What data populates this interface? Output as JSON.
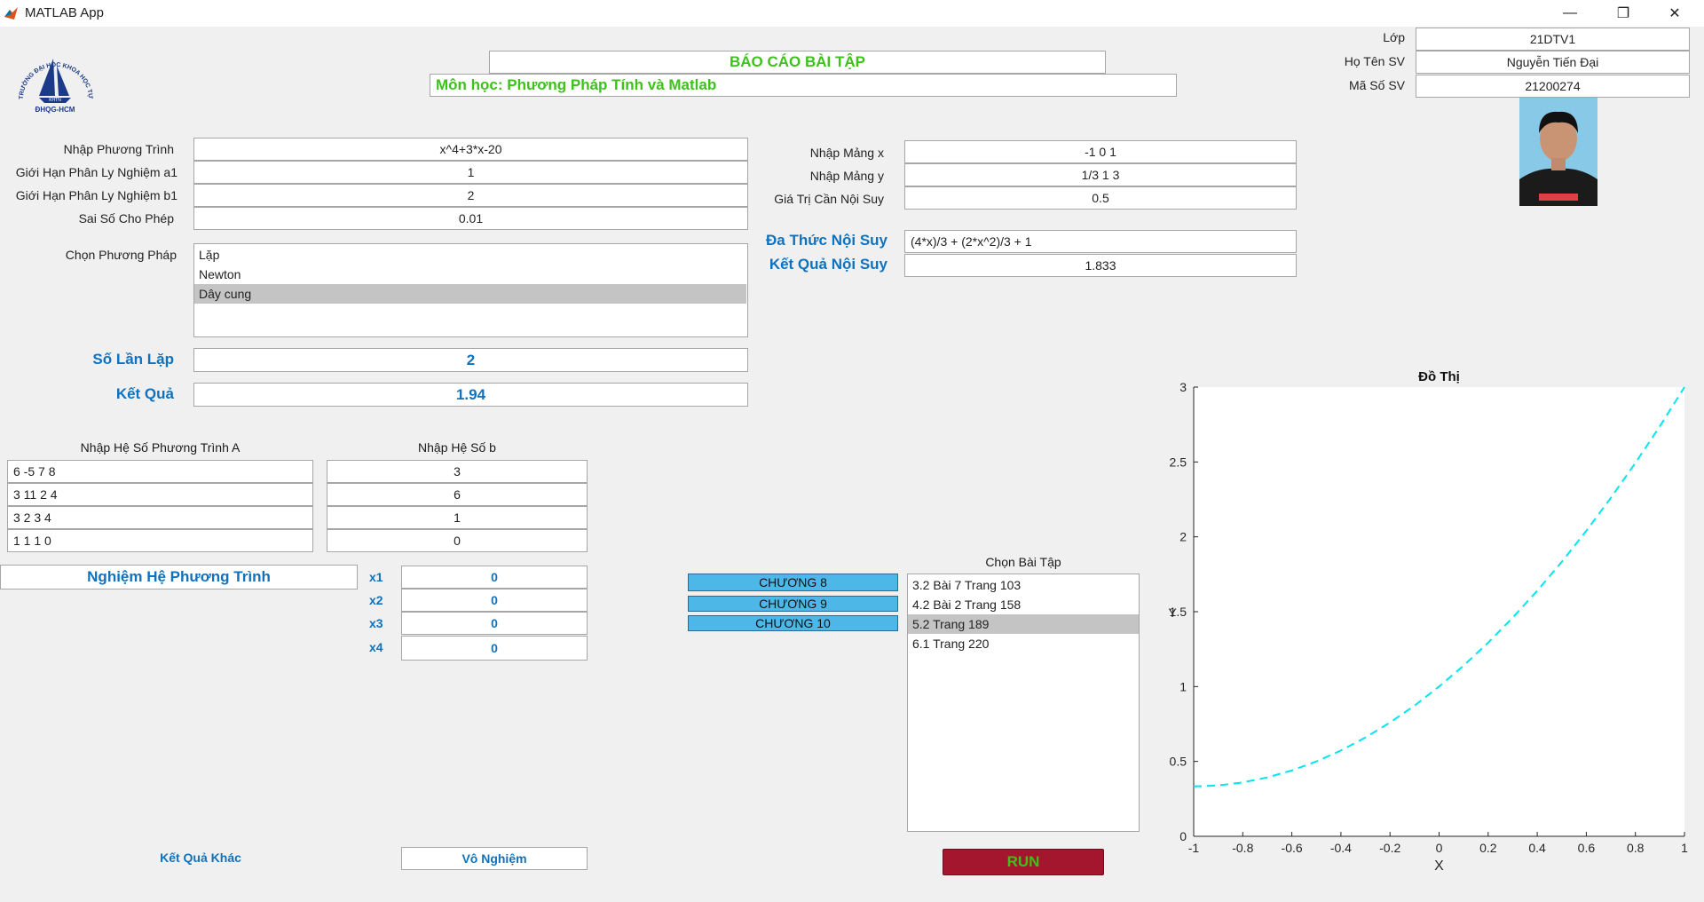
{
  "window": {
    "title": "MATLAB App"
  },
  "header": {
    "report_title": "BÁO CÁO BÀI TẬP",
    "subject": "Môn học: Phương Pháp Tính và Matlab",
    "logo_text": "TRƯỜNG ĐẠI HỌC KHOA HỌC TỰ NHIÊN",
    "logo_sub": "ĐHQG-HCM",
    "logo_badge": "KHTN"
  },
  "student": {
    "class_label": "Lớp",
    "class_value": "21DTV1",
    "name_label": "Họ Tên SV",
    "name_value": "Nguyễn Tiến Đại",
    "id_label": "Mã Số SV",
    "id_value": "21200274"
  },
  "equation": {
    "eq_label": "Nhập Phương Trình",
    "eq_value": "x^4+3*x-20",
    "a1_label": "Giới Hạn Phân Ly Nghiệm a1",
    "a1_value": "1",
    "b1_label": "Giới Hạn Phân Ly Nghiệm b1",
    "b1_value": "2",
    "tol_label": "Sai Số Cho Phép",
    "tol_value": "0.01",
    "method_label": "Chọn Phương Pháp",
    "methods": [
      "Lặp",
      "Newton",
      "Dây cung"
    ],
    "iter_label": "Số Lần Lặp",
    "iter_value": "2",
    "result_label": "Kết Quả",
    "result_value": "1.94"
  },
  "interp": {
    "x_label": "Nhập Mảng x",
    "x_value": "-1 0 1",
    "y_label": "Nhập Mảng y",
    "y_value": "1/3 1 3",
    "v_label": "Giá Trị Cần Nội Suy",
    "v_value": "0.5",
    "poly_label": "Đa Thức Nội Suy",
    "poly_value": "(4*x)/3 + (2*x^2)/3 + 1",
    "res_label": "Kết Quả Nội Suy",
    "res_value": "1.833"
  },
  "system": {
    "a_header": "Nhập Hệ Số Phương Trình A",
    "b_header": "Nhập Hệ Số b",
    "a_rows": [
      "6 -5 7 8",
      "3 11 2 4",
      "3 2 3 4",
      "1 1 1 0"
    ],
    "b_rows": [
      "3",
      "6",
      "1",
      "0"
    ],
    "sol_title": "Nghiệm Hệ Phương Trình",
    "sol_labels": [
      "x1",
      "x2",
      "x3",
      "x4"
    ],
    "sol_values": [
      "0",
      "0",
      "0",
      "0"
    ],
    "other_label": "Kết Quả Khác",
    "other_value": "Vô Nghiệm"
  },
  "exercises": {
    "chapters": [
      "CHƯƠNG 8",
      "CHƯƠNG 9",
      "CHƯƠNG 10"
    ],
    "list_label": "Chọn Bài Tập",
    "items": [
      "3.2 Bài 7 Trang 103",
      "4.2 Bài 2 Trang 158",
      "5.2 Trang 189",
      "6.1 Trang 220"
    ],
    "run_label": "RUN"
  },
  "colors": {
    "accent_blue": "#0e72bf",
    "title_green": "#3cc21a",
    "chapter_bg": "#4db8e8",
    "run_bg": "#a3162e",
    "curve": "#00e5ee"
  },
  "chart_data": {
    "type": "line",
    "title": "Đồ Thị",
    "xlabel": "X",
    "ylabel": "Y",
    "xlim": [
      -1,
      1
    ],
    "ylim": [
      0,
      3
    ],
    "xticks": [
      "-1",
      "-0.8",
      "-0.6",
      "-0.4",
      "-0.2",
      "0",
      "0.2",
      "0.4",
      "0.6",
      "0.8",
      "1"
    ],
    "yticks": [
      "0",
      "0.5",
      "1",
      "1.5",
      "2",
      "2.5",
      "3"
    ],
    "grid": false,
    "line_style": "dashed",
    "series": [
      {
        "x": [
          -1,
          -0.9,
          -0.8,
          -0.7,
          -0.6,
          -0.5,
          -0.4,
          -0.3,
          -0.2,
          -0.1,
          0,
          0.1,
          0.2,
          0.3,
          0.4,
          0.5,
          0.6,
          0.7,
          0.8,
          0.9,
          1
        ],
        "y": [
          0.333,
          0.34,
          0.36,
          0.393,
          0.44,
          0.5,
          0.573,
          0.66,
          0.76,
          0.873,
          1,
          1.14,
          1.293,
          1.46,
          1.64,
          1.833,
          2.04,
          2.26,
          2.493,
          2.74,
          3
        ]
      }
    ]
  }
}
